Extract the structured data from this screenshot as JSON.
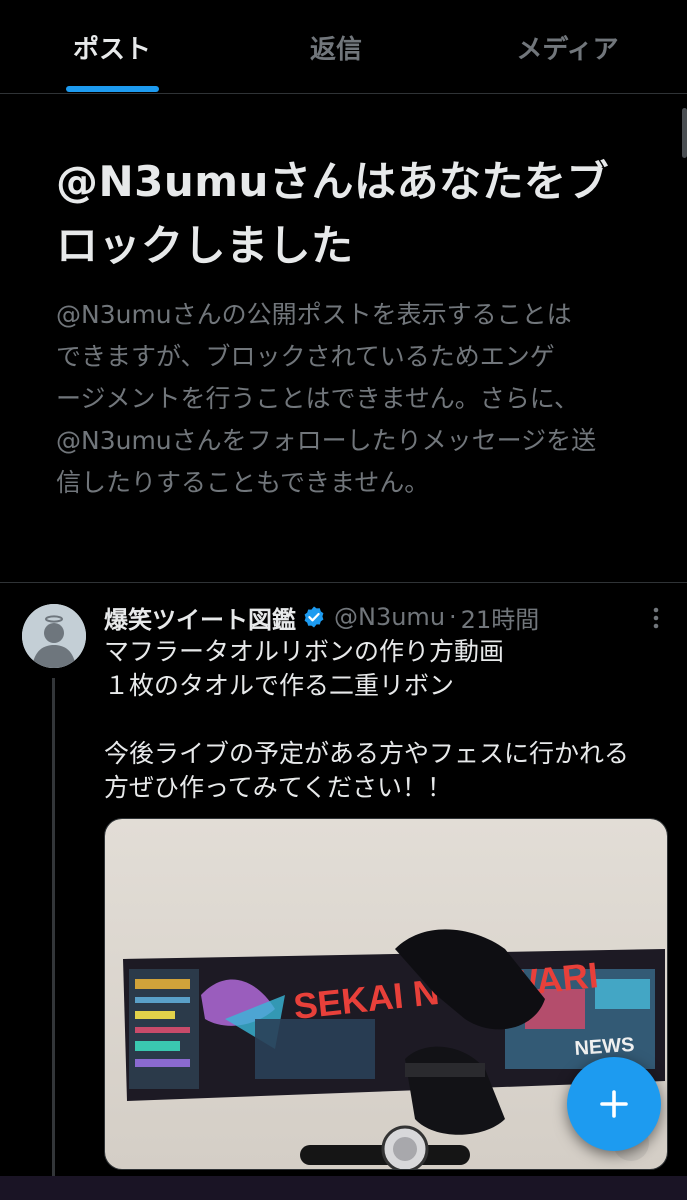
{
  "tabs": [
    {
      "label": "ポスト",
      "active": true
    },
    {
      "label": "返信",
      "active": false
    },
    {
      "label": "メディア",
      "active": false
    }
  ],
  "blocked_notice": {
    "title_line1": "@N3umuさんはあなたをブ",
    "title_line2": "ロックしました",
    "body_lines": [
      "@N3umuさんの公開ポストを表示することは",
      "できますが、ブロックされているためエンゲ",
      "ージメントを行うことはできません。さらに、",
      "@N3umuさんをフォローしたりメッセージを送",
      "信したりすることもできません。"
    ]
  },
  "tweet": {
    "name": "爆笑ツイート図鑑",
    "handle": "@N3umu",
    "dot": "·",
    "time": "21時間",
    "text_lines": [
      "マフラータオルリボンの作り方動画",
      "１枚のタオルで作る二重リボン",
      "",
      "今後ライブの予定がある方やフェスに行かれる",
      "方ぜひ作ってみてください！！"
    ],
    "media_text": "SEKAI NO OWARI",
    "media_subtext": "NEWS"
  },
  "icons": {
    "verified": "verified-badge-icon",
    "more": "more-options-icon",
    "compose": "plus-icon",
    "avatar": "default-avatar-icon"
  },
  "colors": {
    "accent": "#1d9bf0",
    "background": "#000000",
    "text_primary": "#e7e9ea",
    "text_secondary": "#71767b"
  }
}
